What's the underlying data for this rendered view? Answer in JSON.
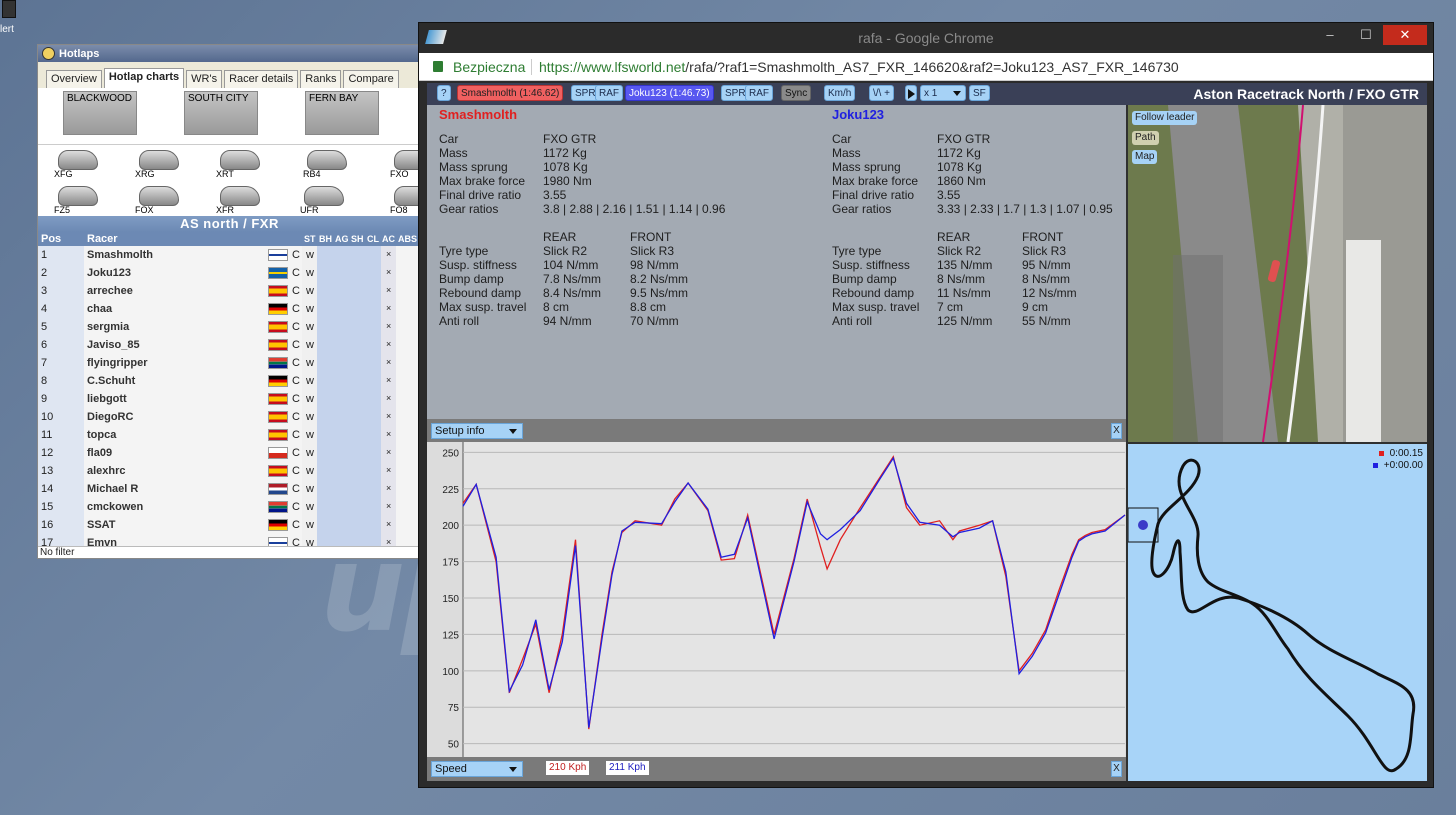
{
  "desktop": {
    "icon_label": "lert",
    "watermark": "up"
  },
  "hotlaps": {
    "title": "Hotlaps",
    "tabs": [
      "Overview",
      "Hotlap charts",
      "WR's",
      "Racer details",
      "Ranks",
      "Compare"
    ],
    "tracks": [
      "BLACKWOOD",
      "SOUTH CITY",
      "FERN BAY"
    ],
    "cars": [
      "XFG",
      "XRG",
      "XRT",
      "RB4",
      "FXO",
      "FZ5",
      "FOX",
      "XFR",
      "UFR",
      "FO8"
    ],
    "combo": "AS north / FXR",
    "columns": [
      "Pos",
      "Racer",
      "ST",
      "BH",
      "AG",
      "SH",
      "CL",
      "AC",
      "ABS"
    ],
    "rows": [
      {
        "pos": "1",
        "name": "Smashmolth",
        "st": "C",
        "ag": "w",
        "ac": "×",
        "flag": "fi"
      },
      {
        "pos": "2",
        "name": "Joku123",
        "st": "C",
        "ag": "w",
        "ac": "×",
        "flag": "se"
      },
      {
        "pos": "3",
        "name": "arrechee",
        "st": "C",
        "ag": "w",
        "ac": "×",
        "flag": "es"
      },
      {
        "pos": "4",
        "name": "chaa",
        "st": "C",
        "ag": "w",
        "ac": "×",
        "flag": "de"
      },
      {
        "pos": "5",
        "name": "sergmia",
        "st": "C",
        "ag": "w",
        "ac": "×",
        "flag": "es"
      },
      {
        "pos": "6",
        "name": "Javiso_85",
        "st": "C",
        "ag": "w",
        "ac": "×",
        "flag": "es"
      },
      {
        "pos": "7",
        "name": "flyingripper",
        "st": "C",
        "ag": "w",
        "ac": "×",
        "flag": "za"
      },
      {
        "pos": "8",
        "name": "C.Schuht",
        "st": "C",
        "ag": "w",
        "ac": "×",
        "flag": "de"
      },
      {
        "pos": "9",
        "name": "liebgott",
        "st": "C",
        "ag": "w",
        "ac": "×",
        "flag": "es"
      },
      {
        "pos": "10",
        "name": "DiegoRC",
        "st": "C",
        "ag": "w",
        "ac": "×",
        "flag": "es"
      },
      {
        "pos": "11",
        "name": "topca",
        "st": "C",
        "ag": "w",
        "ac": "×",
        "flag": "es"
      },
      {
        "pos": "12",
        "name": "fla09",
        "st": "C",
        "ag": "w",
        "ac": "×",
        "flag": "cl"
      },
      {
        "pos": "13",
        "name": "alexhrc",
        "st": "C",
        "ag": "w",
        "ac": "×",
        "flag": "es"
      },
      {
        "pos": "14",
        "name": "Michael R",
        "st": "C",
        "ag": "w",
        "ac": "×",
        "flag": "nl"
      },
      {
        "pos": "15",
        "name": "cmckowen",
        "st": "C",
        "ag": "w",
        "ac": "×",
        "flag": "za"
      },
      {
        "pos": "16",
        "name": "SSAT",
        "st": "C",
        "ag": "w",
        "ac": "×",
        "flag": "de"
      },
      {
        "pos": "17",
        "name": "Emvn",
        "st": "C",
        "ag": "w",
        "ac": "×",
        "flag": "fi"
      }
    ],
    "footer": "No filter"
  },
  "chrome": {
    "title": "rafa - Google Chrome",
    "secure_label": "Bezpieczna",
    "url_host": "https://www.lfsworld.net",
    "url_path": "/rafa/?raf1=Smashmolth_AS7_FXR_146620&raf2=Joku123_AS7_FXR_146730"
  },
  "toolbar": {
    "help": "?",
    "driver1": "Smashmolth (1:46.62)",
    "driver2": "Joku123 (1:46.73)",
    "spr": "SPR",
    "raf": "RAF",
    "sync": "Sync",
    "units": "Km/h",
    "zoom": "\\/\\ +",
    "speed": "x 1",
    "sf": "SF",
    "page_title": "Aston Racetrack North / FXO GTR"
  },
  "setup": {
    "labels": [
      "Car",
      "Mass",
      "Mass sprung",
      "Max brake force",
      "Final drive ratio",
      "Gear ratios"
    ],
    "tyre_labels": [
      "Tyre type",
      "Susp. stiffness",
      "Bump damp",
      "Rebound damp",
      "Max susp. travel",
      "Anti roll"
    ],
    "rear": "REAR",
    "front": "FRONT",
    "d1": {
      "name": "Smashmolth",
      "car": "FXO GTR",
      "mass": "1172 Kg",
      "sprung": "1078 Kg",
      "brake": "1980 Nm",
      "fdr": "3.55",
      "gears": "3.8 | 2.88 | 2.16 | 1.51 | 1.14 | 0.96",
      "rear": [
        "Slick R2",
        "104 N/mm",
        "7.8 Ns/mm",
        "8.4 Ns/mm",
        "8 cm",
        "94 N/mm"
      ],
      "front": [
        "Slick R3",
        "98 N/mm",
        "8.2 Ns/mm",
        "9.5 Ns/mm",
        "8.8 cm",
        "70 N/mm"
      ]
    },
    "d2": {
      "name": "Joku123",
      "car": "FXO GTR",
      "mass": "1172 Kg",
      "sprung": "1078 Kg",
      "brake": "1860 Nm",
      "fdr": "3.55",
      "gears": "3.33 | 2.33 | 1.7 | 1.3 | 1.07 | 0.95",
      "rear": [
        "Slick R2",
        "135 N/mm",
        "8 Ns/mm",
        "11 Ns/mm",
        "7 cm",
        "125 N/mm"
      ],
      "front": [
        "Slick R3",
        "95 N/mm",
        "8 Ns/mm",
        "12 Ns/mm",
        "9 cm",
        "55 N/mm"
      ]
    },
    "dropdown": "Setup info",
    "close": "X"
  },
  "graph": {
    "dropdown": "Speed",
    "close": "X",
    "d1_speed": "210 Kph",
    "d2_speed": "211 Kph",
    "color1": "#e02020",
    "color2": "#2020e0"
  },
  "chart_data": {
    "type": "line",
    "yticks": [
      250,
      225,
      200,
      175,
      150,
      125,
      100,
      75,
      50
    ],
    "ylim": [
      47,
      253
    ],
    "series": [
      {
        "name": "Smashmolth",
        "x": [
          0,
          0.02,
          0.05,
          0.07,
          0.09,
          0.11,
          0.13,
          0.15,
          0.17,
          0.19,
          0.21,
          0.225,
          0.24,
          0.26,
          0.3,
          0.32,
          0.34,
          0.37,
          0.39,
          0.41,
          0.43,
          0.47,
          0.5,
          0.52,
          0.54,
          0.55,
          0.57,
          0.6,
          0.63,
          0.65,
          0.67,
          0.69,
          0.72,
          0.74,
          0.75,
          0.78,
          0.8,
          0.82,
          0.84,
          0.86,
          0.88,
          0.9,
          0.92,
          0.93,
          0.94,
          0.95,
          0.97,
          1.0
        ],
        "y": [
          215,
          228,
          175,
          85,
          108,
          132,
          85,
          125,
          190,
          60,
          125,
          168,
          195,
          203,
          200,
          218,
          229,
          210,
          176,
          177,
          207,
          125,
          177,
          218,
          185,
          170,
          190,
          212,
          233,
          247,
          212,
          200,
          203,
          190,
          196,
          200,
          203,
          165,
          100,
          112,
          128,
          155,
          180,
          190,
          193,
          195,
          197,
          207
        ]
      },
      {
        "name": "Joku123",
        "x": [
          0,
          0.02,
          0.05,
          0.07,
          0.09,
          0.11,
          0.13,
          0.15,
          0.17,
          0.19,
          0.21,
          0.225,
          0.24,
          0.26,
          0.3,
          0.32,
          0.34,
          0.37,
          0.39,
          0.41,
          0.43,
          0.47,
          0.5,
          0.52,
          0.54,
          0.55,
          0.57,
          0.6,
          0.63,
          0.65,
          0.67,
          0.69,
          0.72,
          0.74,
          0.75,
          0.78,
          0.8,
          0.82,
          0.84,
          0.86,
          0.88,
          0.9,
          0.92,
          0.93,
          0.94,
          0.95,
          0.97,
          1.0
        ],
        "y": [
          213,
          228,
          178,
          86,
          104,
          135,
          87,
          120,
          186,
          61,
          122,
          166,
          196,
          202,
          201,
          216,
          229,
          211,
          178,
          180,
          205,
          122,
          175,
          216,
          194,
          190,
          197,
          210,
          232,
          246,
          215,
          202,
          200,
          192,
          195,
          198,
          203,
          168,
          98,
          110,
          126,
          152,
          178,
          189,
          192,
          194,
          196,
          207
        ]
      }
    ]
  },
  "camera": {
    "follow": "Follow leader",
    "path": "Path",
    "map": "Map"
  },
  "map": {
    "t1": "0:00.15",
    "t2": "+0:00.00"
  }
}
